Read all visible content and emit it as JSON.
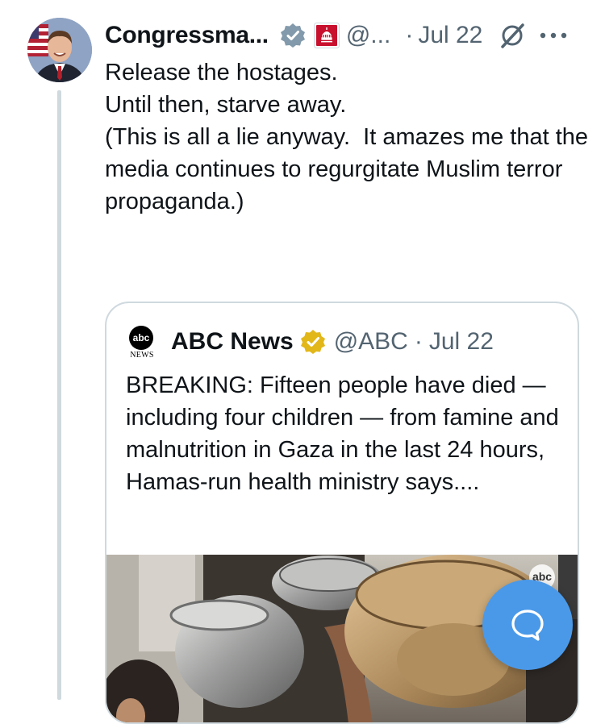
{
  "tweet": {
    "author_name": "Congressma...",
    "handle": "@...",
    "separator": "·",
    "date": "Jul 22",
    "text_lines": [
      "Release the hostages.",
      "",
      "Until then, starve away.",
      "",
      "(This is all a lie anyway.  It amazes me that the media continues to regurgitate Muslim terror propaganda.)"
    ]
  },
  "quoted": {
    "logo_top": "abc",
    "logo_bottom": "NEWS",
    "name": "ABC News",
    "handle": "@ABC",
    "separator": "·",
    "date": "Jul 22",
    "text": "BREAKING: Fifteen people have died — including four children — from famine and malnutrition in Gaza in the last 24 hours, Hamas-run health ministry says....",
    "media_watermark": "abc"
  },
  "icons": {
    "verified": "verified-badge-icon",
    "affiliation": "capitol-affiliation-icon",
    "grok": "grok-icon",
    "more": "more-options-icon",
    "gold_verified": "gold-verified-badge-icon",
    "compose": "chat-bubble-icon"
  },
  "colors": {
    "accent": "#1d9bf0",
    "fab": "#4a99e9",
    "gold": "#e2b719",
    "secondary_text": "#536471",
    "thread_line": "#cfd9de"
  }
}
